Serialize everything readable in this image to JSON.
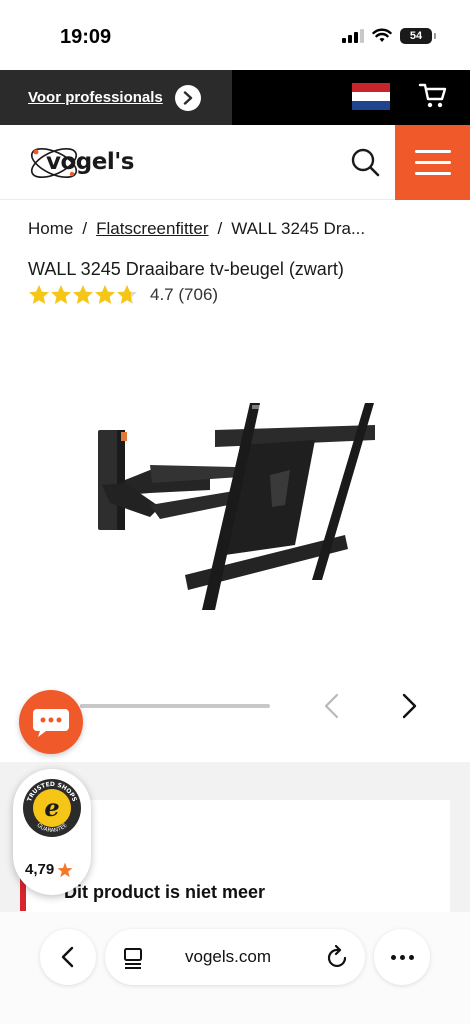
{
  "status_bar": {
    "time": "19:09",
    "battery": "54"
  },
  "pro_bar": {
    "label": "Voor professionals"
  },
  "header": {
    "logo_text": "vogel's"
  },
  "breadcrumb": [
    {
      "label": "Home"
    },
    {
      "label": "Flatscreenfitter"
    },
    {
      "label": "WALL 3245 Dra..."
    }
  ],
  "breadcrumb_separator": "/",
  "product": {
    "title": "WALL 3245 Draaibare tv-beugel (zwart)",
    "rating_value": "4.7",
    "rating_count": "(706)",
    "stars": 4.7
  },
  "gallery": {
    "progress": 0.5
  },
  "notice": {
    "text": "Dit product is niet meer"
  },
  "trusted_shops": {
    "score": "4,79",
    "seal_top": "TRUSTED SHOPS",
    "seal_bottom": "GUARANTEE",
    "seal_letter": "e"
  },
  "browser": {
    "url": "vogels.com"
  },
  "colors": {
    "accent": "#f05a2a",
    "star": "#f5c518",
    "notice_red": "#d7262f"
  }
}
